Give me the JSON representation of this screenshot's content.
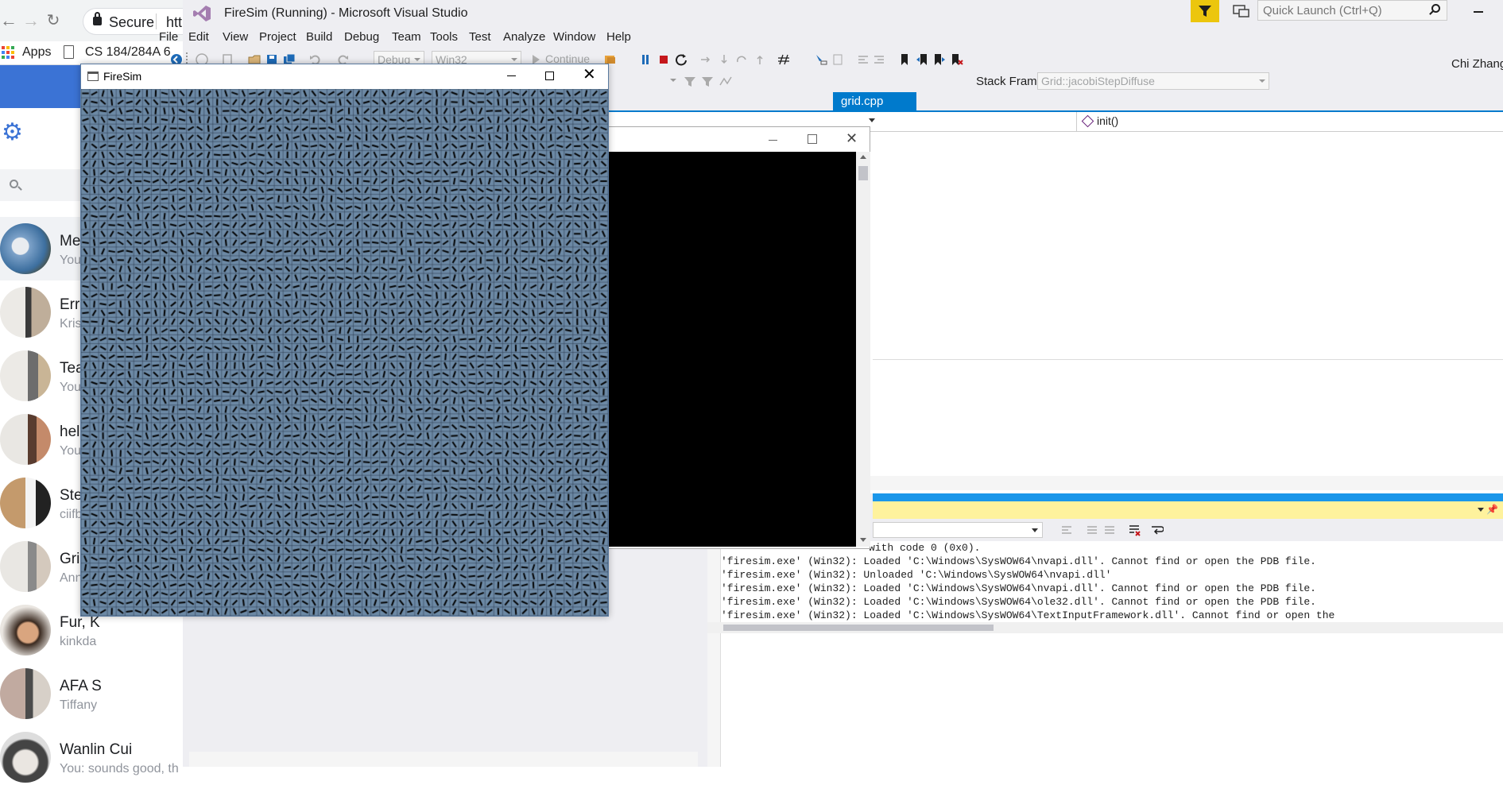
{
  "chrome": {
    "secure_label": "Secure",
    "url_fragment": "htt",
    "bookmarks": {
      "apps": "Apps",
      "cs": "CS 184/284A 6"
    },
    "conversations": [
      {
        "name": "Metal",
        "snippet": "You: H"
      },
      {
        "name": "Error:",
        "snippet": "Kristin"
      },
      {
        "name": "Team",
        "snippet": "You:"
      },
      {
        "name": "hell (r",
        "snippet": "You: yu"
      },
      {
        "name": "Steins",
        "snippet": "ciifbdc"
      },
      {
        "name": "Grill U",
        "snippet": "Anna s"
      },
      {
        "name": "Fur, K",
        "snippet": "kinkda"
      },
      {
        "name": "AFA S",
        "snippet": "Tiffany"
      },
      {
        "name": "Wanlin Cui",
        "snippet": "You: sounds good, th"
      }
    ],
    "accent_color": "#3b73d5"
  },
  "vs": {
    "title": "FireSim (Running) - Microsoft Visual Studio",
    "quick_launch_placeholder": "Quick Launch (Ctrl+Q)",
    "user": "Chi Zhang",
    "menu": [
      "File",
      "Edit",
      "View",
      "Project",
      "Build",
      "Debug",
      "Team",
      "Tools",
      "Test",
      "Analyze",
      "Window",
      "Help"
    ],
    "toolbar": {
      "config": "Debug",
      "platform": "Win32",
      "continue": "Continue"
    },
    "stack_frame_label": "Stack Frame:",
    "stack_frame_value": "Grid::jacobiStepDiffuse",
    "active_tab": "grid.cpp",
    "nav_function": "init()",
    "output_lines": [
      "with code 0 (0x0).",
      "'firesim.exe' (Win32): Loaded 'C:\\Windows\\SysWOW64\\nvapi.dll'. Cannot find or open the PDB file.",
      "'firesim.exe' (Win32): Unloaded 'C:\\Windows\\SysWOW64\\nvapi.dll'",
      "'firesim.exe' (Win32): Loaded 'C:\\Windows\\SysWOW64\\nvapi.dll'. Cannot find or open the PDB file.",
      "'firesim.exe' (Win32): Loaded 'C:\\Windows\\SysWOW64\\ole32.dll'. Cannot find or open the PDB file.",
      "'firesim.exe' (Win32): Loaded 'C:\\Windows\\SysWOW64\\TextInputFramework.dll'. Cannot find or open the"
    ],
    "accent_color": "#007acc",
    "filter_color": "#ecc60d"
  },
  "firesim": {
    "title": "FireSim",
    "grid_color": "#6d8aa6"
  }
}
